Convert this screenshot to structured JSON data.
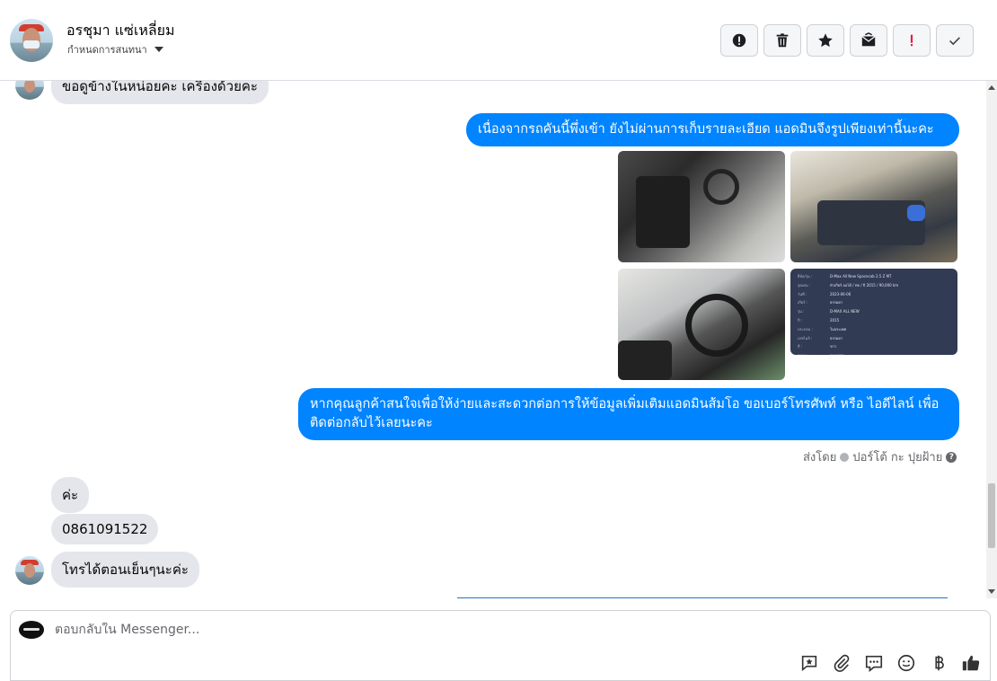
{
  "header": {
    "contact_name": "อรชุมา แซ่เหลี่ยม",
    "assign_label": "กำหนดการสนทนา"
  },
  "actions": [
    {
      "icon": "alert-circle-icon",
      "name": "mark-spam-button"
    },
    {
      "icon": "trash-icon",
      "name": "delete-button"
    },
    {
      "icon": "star-icon",
      "name": "star-button"
    },
    {
      "icon": "mark-unread-icon",
      "name": "mark-unread-button"
    },
    {
      "icon": "exclamation-icon",
      "name": "follow-up-button"
    },
    {
      "icon": "check-icon",
      "name": "mark-done-button"
    }
  ],
  "messages": {
    "partial_incoming": "ขอดูข้างในหน่อยคะ เครื่องด้วยคะ",
    "outgoing_1": "เนื่องจากรถคันนี้พึ่งเข้า ยังไม่ผ่านการเก็บรายละเอียด แอดมินจึงรูปเพียงเท่านี้นะคะ",
    "outgoing_2": "หากคุณลูกค้าสนใจเพื่อให้ง่ายและสะดวกต่อการให้ข้อมูลเพิ่มเติมแอดมินส้มโอ ขอเบอร์โทรศัพท์ หรือ ไอดีไลน์ เพื่อติดต่อกลับไว้เลยนะคะ",
    "sent_by_prefix": "ส่งโดย",
    "sent_by_name": "ปอร์โต้ กะ ปุยฝ้าย",
    "incoming_1": "ค่ะ",
    "incoming_2": "0861091522",
    "incoming_3": "โทรได้ตอนเย็นๆนะค่ะ"
  },
  "spec_sheet": [
    [
      "ยี่ห้อ/รุ่น :",
      "D-Max All New Spacecab 2.5 Z MT"
    ],
    [
      "จุดเด่น :",
      "หัวเกียร์ ออโต้ / ท่อ / ปี 2015 / 90,000 km"
    ],
    [
      "วันที่ :",
      "2023-06-06"
    ],
    [
      "เกียร์ :",
      "ธรรมดา"
    ],
    [
      "รุ่น :",
      "D-MAX ALL NEW"
    ],
    [
      "ปี :",
      "2015"
    ],
    [
      "ประกอบ :",
      "ในประเทศ"
    ],
    [
      "เลขไมล์ :",
      "ธรรมดา"
    ],
    [
      "สี :",
      "ขาว"
    ],
    [
      "สาขา :",
      "กรุงเทพฯ"
    ]
  ],
  "composer": {
    "placeholder": "ตอบกลับใน Messenger..."
  },
  "tools": [
    "saved-reply-icon",
    "attachment-icon",
    "chat-bubble-icon",
    "emoji-icon",
    "baht-icon",
    "thumbs-up-icon"
  ]
}
